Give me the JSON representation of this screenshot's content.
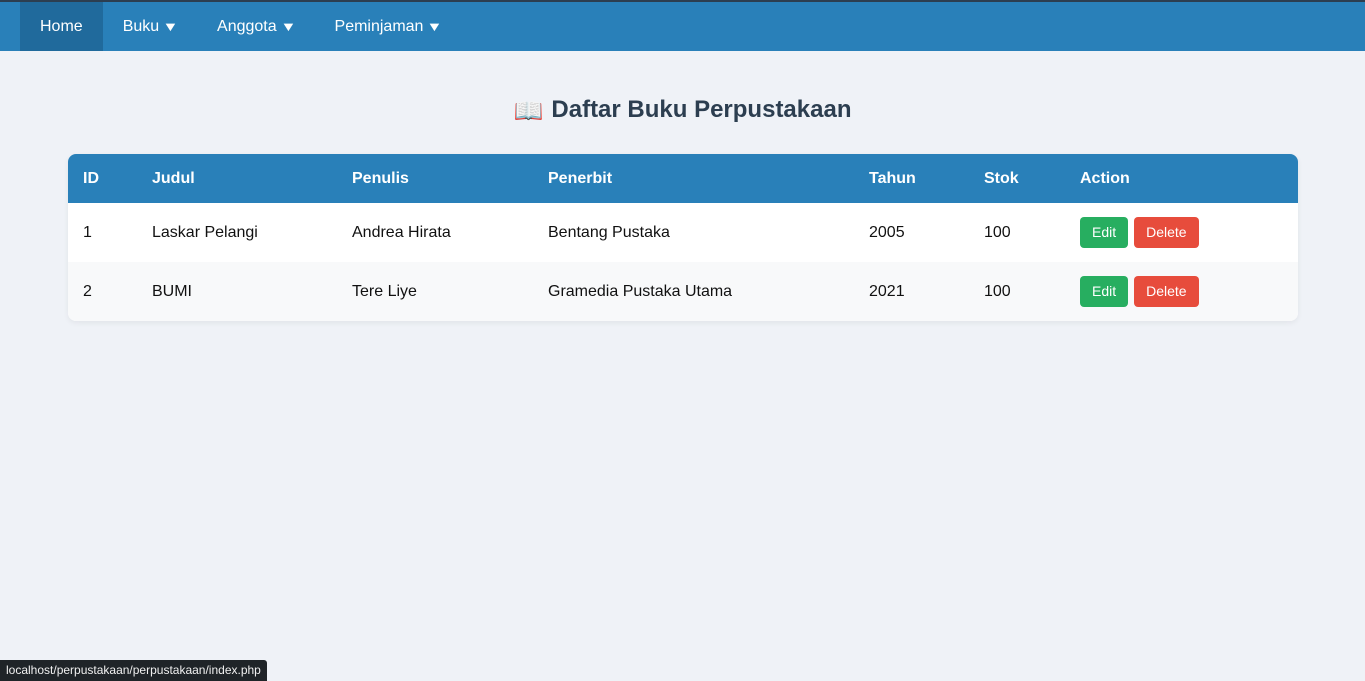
{
  "nav": {
    "items": [
      {
        "label": "Home",
        "caret": ""
      },
      {
        "label": "Buku",
        "caret": "▼"
      },
      {
        "label": "Anggota",
        "caret": "▼"
      },
      {
        "label": "Peminjaman",
        "caret": "▼"
      }
    ]
  },
  "page": {
    "icon": "📖",
    "title": "Daftar Buku Perpustakaan"
  },
  "table": {
    "headers": [
      "ID",
      "Judul",
      "Penulis",
      "Penerbit",
      "Tahun",
      "Stok",
      "Action"
    ],
    "rows": [
      {
        "id": "1",
        "judul": "Laskar Pelangi",
        "penulis": "Andrea Hirata",
        "penerbit": "Bentang Pustaka",
        "tahun": "2005",
        "stok": "100",
        "edit": "Edit",
        "delete": "Delete"
      },
      {
        "id": "2",
        "judul": "BUMI",
        "penulis": "Tere Liye",
        "penerbit": "Gramedia Pustaka Utama",
        "tahun": "2021",
        "stok": "100",
        "edit": "Edit",
        "delete": "Delete"
      }
    ]
  },
  "status": {
    "url": "localhost/perpustakaan/perpustakaan/index.php"
  },
  "colors": {
    "nav_bg": "#2980b9",
    "edit": "#27ae60",
    "delete": "#e74c3c"
  }
}
